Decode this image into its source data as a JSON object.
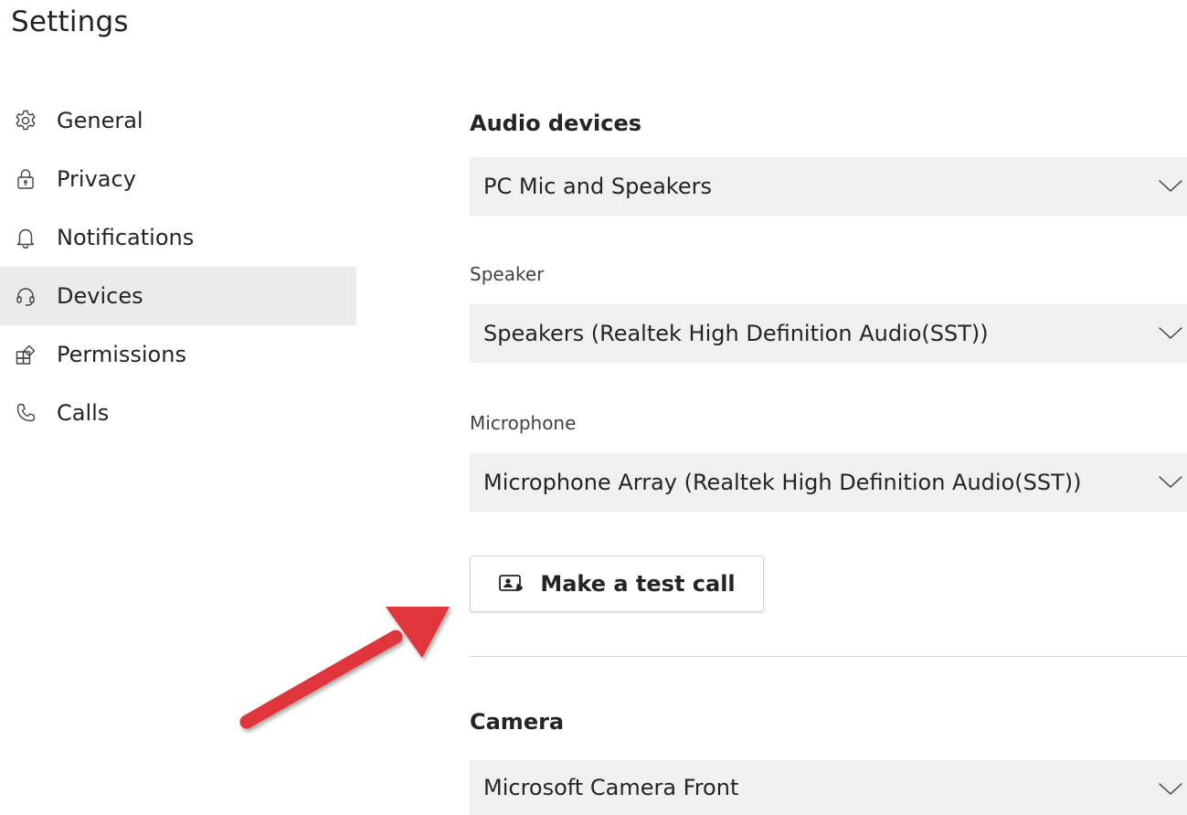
{
  "page": {
    "title": "Settings"
  },
  "sidebar": {
    "items": [
      {
        "label": "General",
        "icon": "gear-icon",
        "active": false
      },
      {
        "label": "Privacy",
        "icon": "lock-icon",
        "active": false
      },
      {
        "label": "Notifications",
        "icon": "bell-icon",
        "active": false
      },
      {
        "label": "Devices",
        "icon": "headset-icon",
        "active": true
      },
      {
        "label": "Permissions",
        "icon": "permissions-icon",
        "active": false
      },
      {
        "label": "Calls",
        "icon": "phone-icon",
        "active": false
      }
    ]
  },
  "main": {
    "audio_heading": "Audio devices",
    "audio_device": {
      "value": "PC Mic and Speakers"
    },
    "speaker": {
      "label": "Speaker",
      "value": "Speakers (Realtek High Definition Audio(SST))"
    },
    "microphone": {
      "label": "Microphone",
      "value": "Microphone Array (Realtek High Definition Audio(SST))"
    },
    "test_call_label": "Make a test call",
    "camera_heading": "Camera",
    "camera": {
      "value": "Microsoft Camera Front"
    }
  },
  "colors": {
    "active_nav_bg": "#ecebea",
    "select_bg": "#f0f0f0",
    "annotation_arrow": "#e0353a",
    "text": "#252423"
  }
}
